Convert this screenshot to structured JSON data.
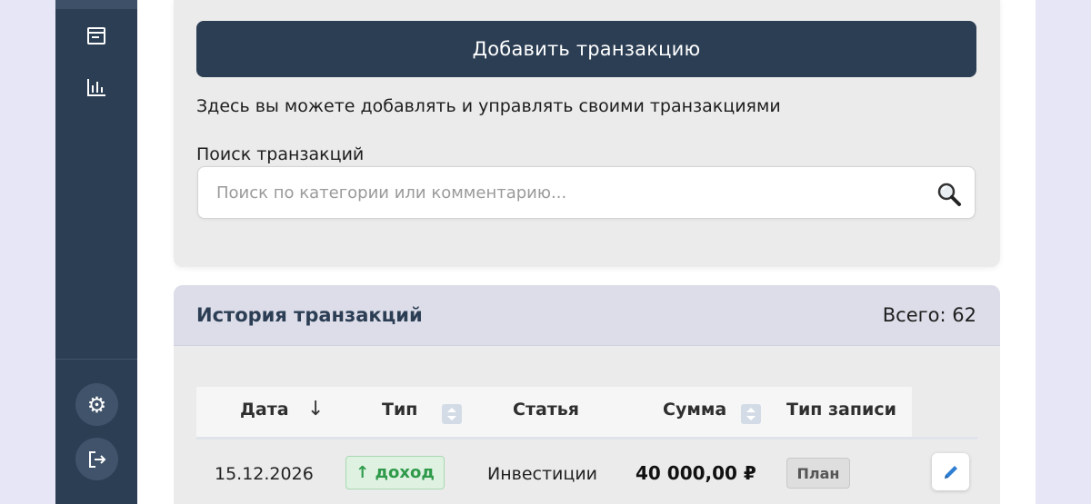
{
  "colors": {
    "sidebar": "#2c3e54",
    "primary_button": "#2c3e54",
    "income_green": "#2f9a4a",
    "page_background": "#e6e6f7"
  },
  "sidebar": {
    "nav_icons": [
      "calendar-icon",
      "bar-chart-icon"
    ],
    "bottom_icons": [
      "gear-icon",
      "logout-icon"
    ]
  },
  "actions": {
    "add_transaction_label": "Добавить транзакцию"
  },
  "description": "Здесь вы можете добавлять и управлять своими транзакциями",
  "search": {
    "label": "Поиск транзакций",
    "placeholder": "Поиск по категории или комментарию...",
    "value": ""
  },
  "history": {
    "title": "История транзакций",
    "total_label": "Всего: 62",
    "columns": {
      "date": "Дата",
      "type": "Тип",
      "category": "Статья",
      "amount": "Сумма",
      "record_type": "Тип записи"
    },
    "date_sort_arrow": "↓",
    "rows": [
      {
        "date": "15.12.2026",
        "type": "↑ доход",
        "category": "Инвестиции",
        "amount": "40 000,00 ₽",
        "record_type": "План"
      }
    ]
  }
}
